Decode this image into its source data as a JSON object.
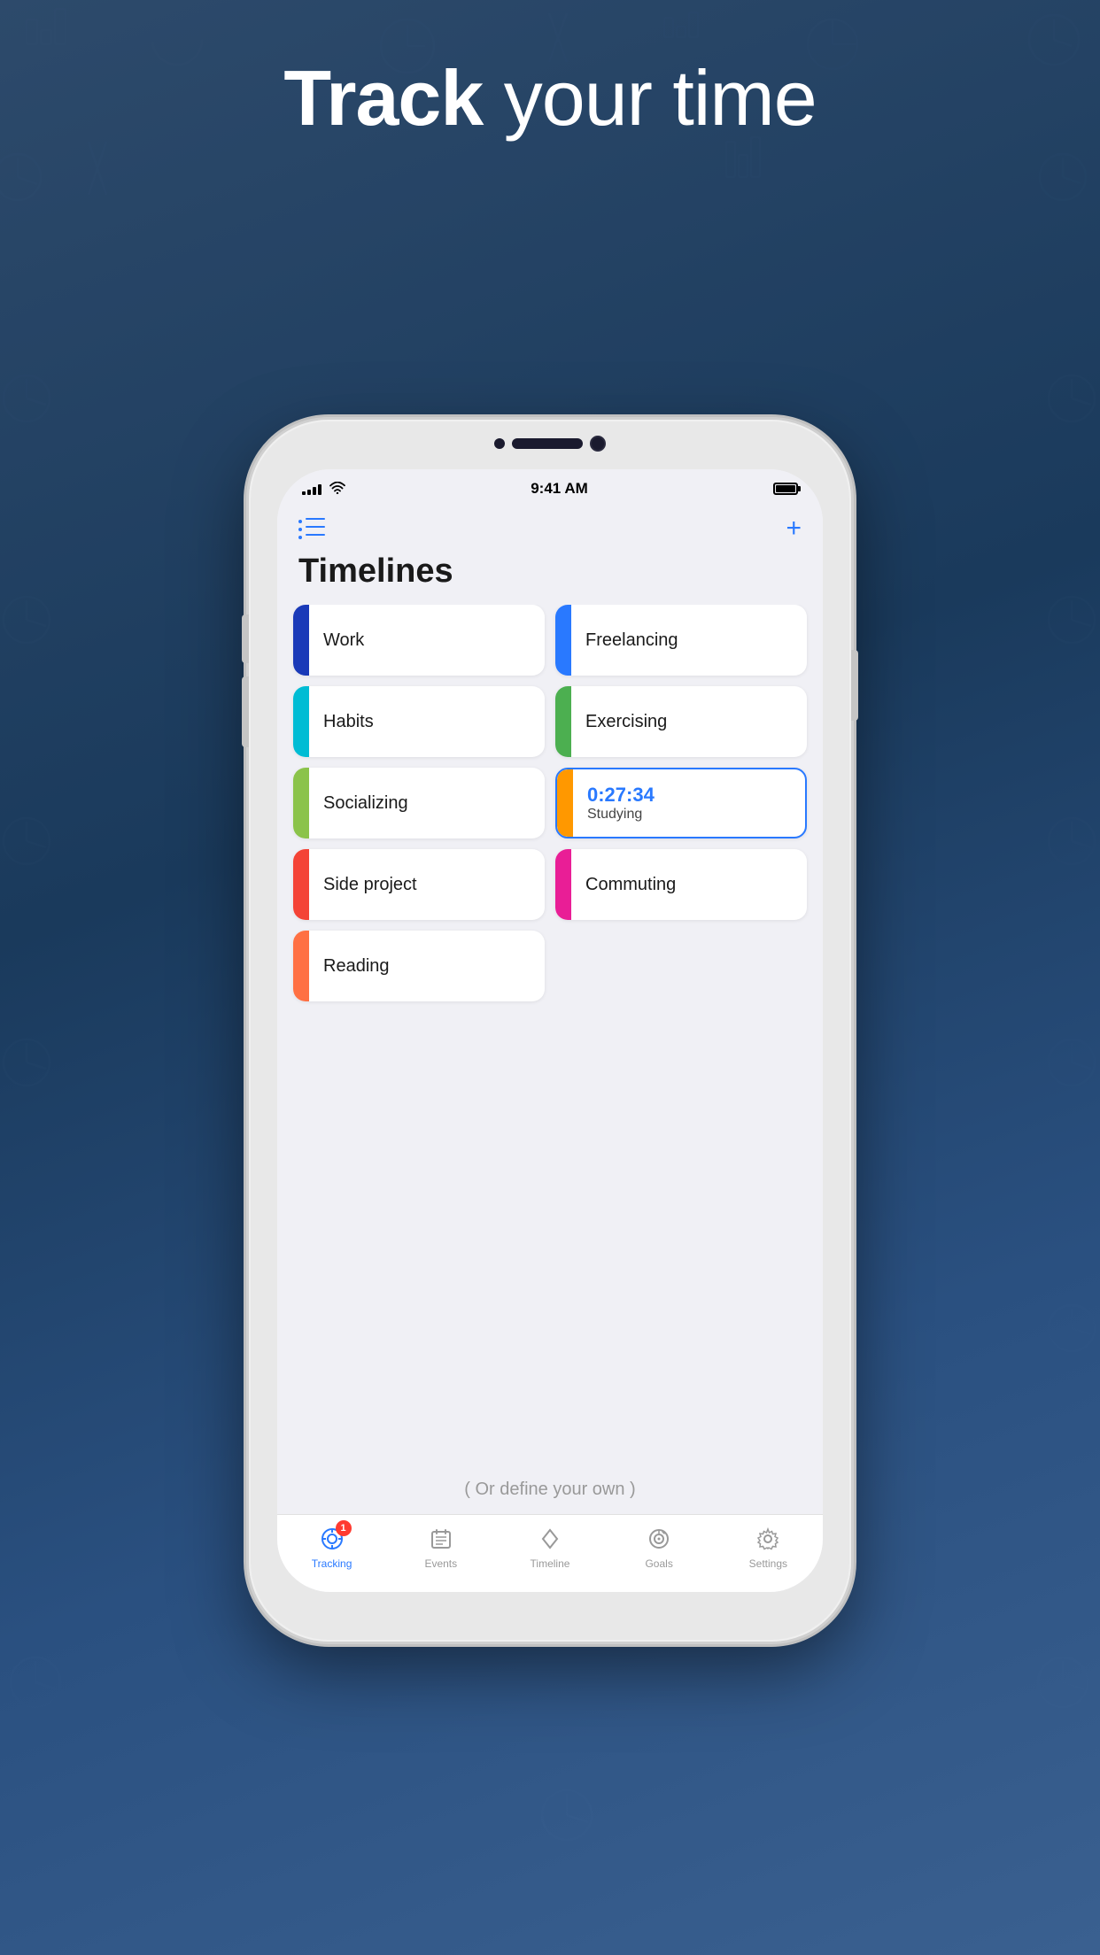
{
  "background": {
    "title_normal": "your time",
    "title_bold": "Track"
  },
  "status_bar": {
    "time": "9:41 AM",
    "signal_bars": [
      4,
      6,
      8,
      10,
      12
    ],
    "battery_label": "Battery"
  },
  "nav": {
    "add_btn": "+"
  },
  "page": {
    "title": "Timelines"
  },
  "cards": [
    {
      "id": "work",
      "label": "Work",
      "color": "#1a3ab8",
      "active": false,
      "timer": null
    },
    {
      "id": "freelancing",
      "label": "Freelancing",
      "color": "#2979ff",
      "active": false,
      "timer": null
    },
    {
      "id": "habits",
      "label": "Habits",
      "color": "#00bcd4",
      "active": false,
      "timer": null
    },
    {
      "id": "exercising",
      "label": "Exercising",
      "color": "#4caf50",
      "active": false,
      "timer": null
    },
    {
      "id": "socializing",
      "label": "Socializing",
      "color": "#8bc34a",
      "active": false,
      "timer": null
    },
    {
      "id": "studying",
      "label": "Studying",
      "color": "#ff9800",
      "active": true,
      "timer": "0:27:34"
    },
    {
      "id": "side-project",
      "label": "Side project",
      "color": "#f44336",
      "active": false,
      "timer": null
    },
    {
      "id": "commuting",
      "label": "Commuting",
      "color": "#e91e96",
      "active": false,
      "timer": null
    },
    {
      "id": "reading",
      "label": "Reading",
      "color": "#ff7043",
      "active": false,
      "timer": null
    }
  ],
  "define_own": "( Or define your own )",
  "tabs": [
    {
      "id": "tracking",
      "label": "Tracking",
      "active": true,
      "badge": "1"
    },
    {
      "id": "events",
      "label": "Events",
      "active": false,
      "badge": null
    },
    {
      "id": "timeline",
      "label": "Timeline",
      "active": false,
      "badge": null
    },
    {
      "id": "goals",
      "label": "Goals",
      "active": false,
      "badge": null
    },
    {
      "id": "settings",
      "label": "Settings",
      "active": false,
      "badge": null
    }
  ]
}
